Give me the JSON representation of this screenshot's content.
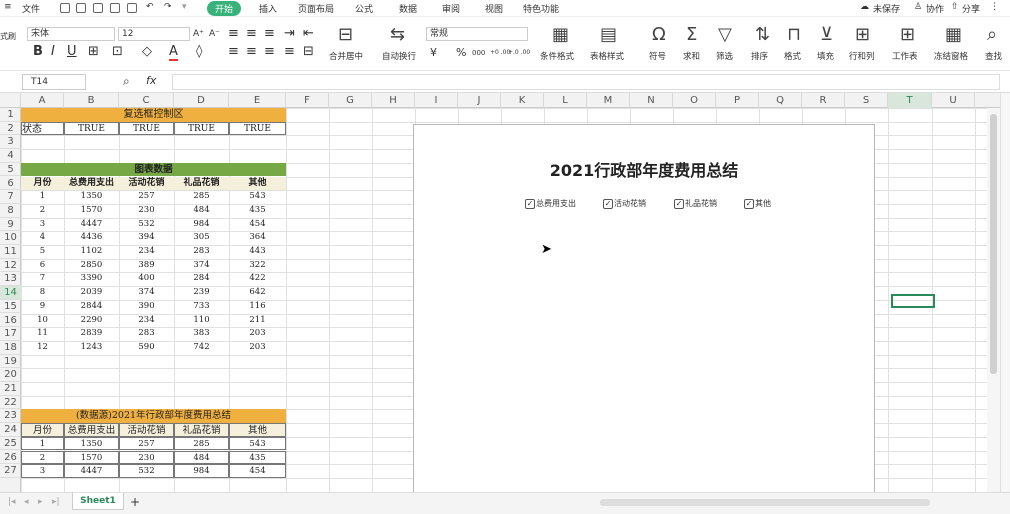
{
  "menubar": {
    "file": "文件",
    "tabs": [
      "开始",
      "插入",
      "页面布局",
      "公式",
      "数据",
      "审阅",
      "视图",
      "特色功能"
    ],
    "active_tab": "开始",
    "unsaved": "未保存",
    "collab": "协作",
    "share": "分享"
  },
  "toolbar": {
    "font_name": "宋体",
    "font_size": "12",
    "number_format": "常规",
    "merge": "合并居中",
    "wrap": "自动换行",
    "cond_format": "条件格式",
    "table_style": "表格样式",
    "symbol": "符号",
    "sum": "求和",
    "filter": "筛选",
    "sort": "排序",
    "format": "格式",
    "fill": "填充",
    "rowcol": "行和列",
    "worksheet": "工作表",
    "freeze": "冻结窗格",
    "find": "查找",
    "brush": "式刷",
    "percent": "%",
    "thousands": "000",
    "dec_inc": "+0 .00",
    "dec_dec": "+.0 .00"
  },
  "formula": {
    "cell_ref": "T14",
    "fx": "fx"
  },
  "columns": [
    "A",
    "B",
    "C",
    "D",
    "E",
    "F",
    "G",
    "H",
    "I",
    "J",
    "K",
    "L",
    "M",
    "N",
    "O",
    "P",
    "Q",
    "R",
    "S",
    "T",
    "U"
  ],
  "rows": [
    "1",
    "2",
    "3",
    "4",
    "5",
    "6",
    "7",
    "8",
    "9",
    "10",
    "11",
    "12",
    "13",
    "14",
    "15",
    "16",
    "17",
    "18",
    "19",
    "20",
    "21",
    "22",
    "23",
    "24",
    "25",
    "26",
    "27"
  ],
  "sheet": {
    "control_title": "复选框控制区",
    "status_label": "状态",
    "status_values": [
      "TRUE",
      "TRUE",
      "TRUE",
      "TRUE"
    ],
    "chart_data_title": "图表数据",
    "headers": [
      "月份",
      "总费用支出",
      "活动花销",
      "礼品花销",
      "其他"
    ],
    "data": [
      [
        "1",
        "1350",
        "257",
        "285",
        "543"
      ],
      [
        "2",
        "1570",
        "230",
        "484",
        "435"
      ],
      [
        "3",
        "4447",
        "532",
        "984",
        "454"
      ],
      [
        "4",
        "4436",
        "394",
        "305",
        "364"
      ],
      [
        "5",
        "1102",
        "234",
        "283",
        "443"
      ],
      [
        "6",
        "2850",
        "389",
        "374",
        "322"
      ],
      [
        "7",
        "3390",
        "400",
        "284",
        "422"
      ],
      [
        "8",
        "2039",
        "374",
        "239",
        "642"
      ],
      [
        "9",
        "2844",
        "390",
        "733",
        "116"
      ],
      [
        "10",
        "2290",
        "234",
        "110",
        "211"
      ],
      [
        "11",
        "2839",
        "283",
        "383",
        "203"
      ],
      [
        "12",
        "1243",
        "590",
        "742",
        "203"
      ]
    ],
    "source_title": "(数据源)2021年行政部年度费用总结",
    "source_data": [
      [
        "1",
        "1350",
        "257",
        "285",
        "543"
      ],
      [
        "2",
        "1570",
        "230",
        "484",
        "435"
      ],
      [
        "3",
        "4447",
        "532",
        "984",
        "454"
      ]
    ]
  },
  "chart": {
    "title": "2021行政部年度费用总结",
    "checkboxes": [
      {
        "label": "总费用支出",
        "checked": true
      },
      {
        "label": "活动花销",
        "checked": true
      },
      {
        "label": "礼品花销",
        "checked": true
      },
      {
        "label": "其他",
        "checked": true
      }
    ]
  },
  "sheetbar": {
    "tab": "Sheet1",
    "add": "+"
  },
  "colors": {
    "orange": "#f0b040",
    "green": "#76a845",
    "header_fill": "#f4f0dc",
    "accent": "#36b27a"
  }
}
